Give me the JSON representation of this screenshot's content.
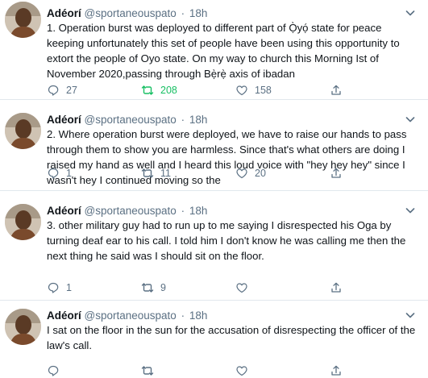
{
  "author": {
    "name": "Adéorí",
    "handle": "@sportaneouspato",
    "separator": "·"
  },
  "tweets": [
    {
      "time": "18h",
      "text": "1. Operation burst was deployed to different part of Ọ̀yọ́ state for peace keeping unfortunately this set of people have been using this opportunity to extort the  people of Oyo state. On my way to church this Morning Ist of November 2020,passing through Bẹ̀rẹ̀ axis of ibadan",
      "replies": "27",
      "retweets": "208",
      "likes": "158",
      "retweeted": true
    },
    {
      "time": "18h",
      "text": "2. Where operation burst were deployed, we have to raise our hands to pass through them to show you are harmless. Since  that's what others are doing I raised my hand as well and I heard this loud voice with \"hey hey hey\" since I wasn't hey I continued moving so the",
      "replies": "1",
      "retweets": "11",
      "likes": "20",
      "retweeted": false
    },
    {
      "time": "18h",
      "text": "3.  other military guy had to run up to me saying I disrespected his Oga by turning deaf ear  to his call. I told him I don't know he was calling me then the next thing  he said was I should sit on the floor.",
      "replies": "1",
      "retweets": "9",
      "likes": "",
      "retweeted": false
    },
    {
      "time": "18h",
      "text": "I sat on the floor in the sun  for the accusation of disrespecting the officer of the law's call.",
      "replies": "",
      "retweets": "",
      "likes": "",
      "retweeted": false
    }
  ],
  "colors": {
    "muted": "#5b7083",
    "retweet_active": "#17bf63",
    "divider": "#e1e8ed"
  }
}
